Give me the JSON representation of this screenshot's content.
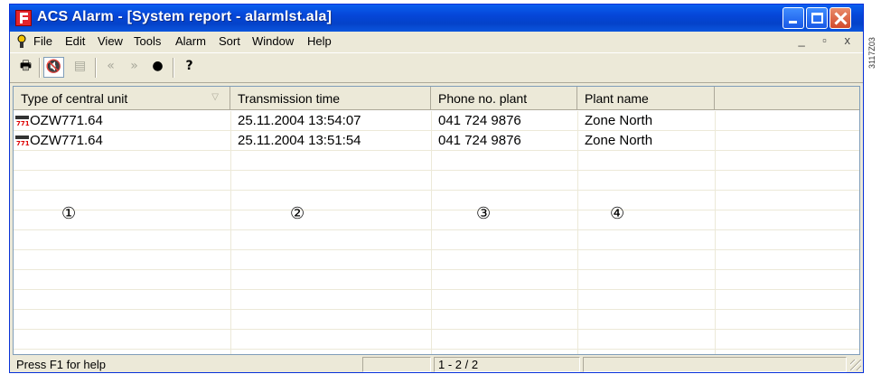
{
  "window": {
    "title": "ACS Alarm - [System report - alarmlst.ala]"
  },
  "menubar": {
    "items": [
      "File",
      "Edit",
      "View",
      "Tools",
      "Alarm",
      "Sort",
      "Window",
      "Help"
    ],
    "mdi_controls": "_ ▫ x"
  },
  "toolbar": {
    "buttons": [
      {
        "icon": "print-icon",
        "glyph": "🖶"
      },
      {
        "icon": "speaker-mute-icon",
        "glyph": "🔇"
      },
      {
        "icon": "properties-icon",
        "glyph": "▤"
      },
      {
        "icon": "rewind-icon",
        "glyph": "«"
      },
      {
        "icon": "forward-icon",
        "glyph": "»"
      },
      {
        "icon": "record-icon",
        "glyph": "●"
      },
      {
        "icon": "help-icon",
        "glyph": "?"
      }
    ]
  },
  "list": {
    "columns": [
      "Type of central unit",
      "Transmission time",
      "Phone no. plant",
      "Plant name"
    ],
    "rows": [
      {
        "unit_icon_number": "771",
        "type": "OZW771.64",
        "time": "25.11.2004 13:54:07",
        "phone": "041 724 9876",
        "plant": "Zone North"
      },
      {
        "unit_icon_number": "771",
        "type": "OZW771.64",
        "time": "25.11.2004 13:51:54",
        "phone": "041 724 9876",
        "plant": "Zone North"
      }
    ],
    "callouts": [
      "①",
      "②",
      "③",
      "④"
    ]
  },
  "statusbar": {
    "help_text": "Press F1 for help",
    "pane2": "",
    "record_count": "1 - 2 / 2",
    "pane4": ""
  },
  "side_code": "3117Z03",
  "colors": {
    "titlebar": "#0a5fef",
    "close_button": "#d3492b",
    "face": "#ece9d8",
    "list_border": "#7f9db9"
  }
}
